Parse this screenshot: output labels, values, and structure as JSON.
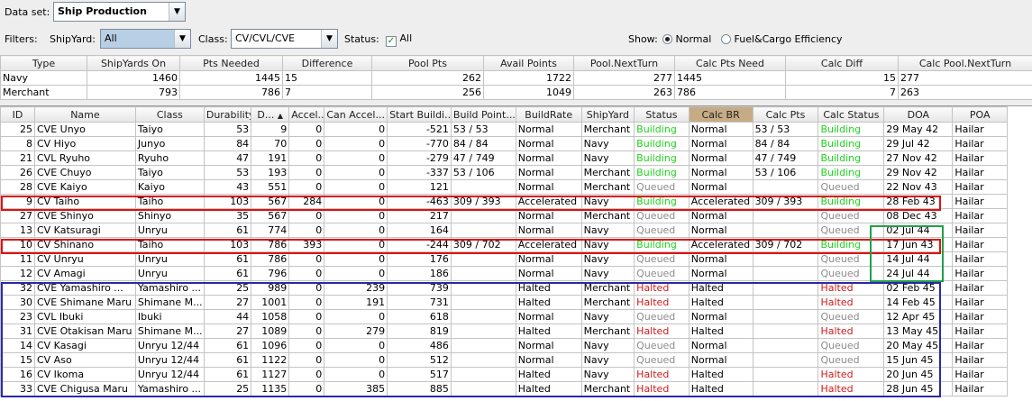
{
  "toolbar": {
    "dataset_label": "Data set:",
    "dataset_value": "Ship Production",
    "filters_label": "Filters:",
    "shipyard_label": "ShipYard:",
    "shipyard_value": "All",
    "class_label": "Class:",
    "class_value": "CV/CVL/CVE",
    "status_label": "Status:",
    "status_value": "All",
    "show_label": "Show:",
    "show_normal": "Normal",
    "show_fuel": "Fuel&Cargo Efficiency"
  },
  "summary": {
    "headers": [
      "Type",
      "ShipYards On",
      "Pts Needed",
      "Difference",
      "Pool Pts",
      "Avail Points",
      "Pool.NextTurn",
      "Calc Pts Need",
      "Calc Diff",
      "Calc Pool.NextTurn"
    ],
    "rows": [
      [
        "Navy",
        "1460",
        "1445",
        "15",
        "262",
        "1722",
        "277",
        "1445",
        "15",
        "277"
      ],
      [
        "Merchant",
        "793",
        "786",
        "7",
        "256",
        "1049",
        "263",
        "786",
        "7",
        "263"
      ]
    ]
  },
  "table": {
    "headers": [
      "ID",
      "Name",
      "Class",
      "Durability",
      "D...",
      "Accel...",
      "Can Accel...",
      "Start Buildi...",
      "Build Point...",
      "BuildRate",
      "ShipYard",
      "Status",
      "Calc BR",
      "Calc Pts",
      "Calc Status",
      "DOA",
      "POA"
    ],
    "sort_arrow": "▲",
    "rows": [
      [
        "25",
        "CVE Unyo",
        "Taiyo",
        "53",
        "9",
        "0",
        "0",
        "-521",
        "53 / 53",
        "Normal",
        "Merchant",
        "Building",
        "Normal",
        "53 / 53",
        "Building",
        "29 May 42",
        "Hailar"
      ],
      [
        "8",
        "CV Hiyo",
        "Junyo",
        "84",
        "70",
        "0",
        "0",
        "-770",
        "84 / 84",
        "Normal",
        "Navy",
        "Building",
        "Normal",
        "84 / 84",
        "Building",
        "29 Jul 42",
        "Hailar"
      ],
      [
        "21",
        "CVL Ryuho",
        "Ryuho",
        "47",
        "191",
        "0",
        "0",
        "-279",
        "47 / 749",
        "Normal",
        "Navy",
        "Building",
        "Normal",
        "47 / 749",
        "Building",
        "27 Nov 42",
        "Hailar"
      ],
      [
        "26",
        "CVE Chuyo",
        "Taiyo",
        "53",
        "193",
        "0",
        "0",
        "-337",
        "53 / 106",
        "Normal",
        "Merchant",
        "Building",
        "Normal",
        "53 / 106",
        "Building",
        "29 Nov 42",
        "Hailar"
      ],
      [
        "28",
        "CVE Kaiyo",
        "Kaiyo",
        "43",
        "551",
        "0",
        "0",
        "121",
        "",
        "Normal",
        "Merchant",
        "Queued",
        "Normal",
        "",
        "Queued",
        "22 Nov 43",
        "Hailar"
      ],
      [
        "9",
        "CV Taiho",
        "Taiho",
        "103",
        "567",
        "284",
        "0",
        "-463",
        "309 / 393",
        "Accelerated",
        "Navy",
        "Building",
        "Accelerated",
        "309 / 393",
        "Building",
        "28 Feb 43",
        "Hailar"
      ],
      [
        "27",
        "CVE Shinyo",
        "Shinyo",
        "35",
        "567",
        "0",
        "0",
        "217",
        "",
        "Normal",
        "Merchant",
        "Queued",
        "Normal",
        "",
        "Queued",
        "08 Dec 43",
        "Hailar"
      ],
      [
        "13",
        "CV Katsuragi",
        "Unryu",
        "61",
        "774",
        "0",
        "0",
        "164",
        "",
        "Normal",
        "Navy",
        "Queued",
        "Normal",
        "",
        "Queued",
        "02 Jul 44",
        "Hailar"
      ],
      [
        "10",
        "CV Shinano",
        "Taiho",
        "103",
        "786",
        "393",
        "0",
        "-244",
        "309 / 702",
        "Accelerated",
        "Navy",
        "Building",
        "Accelerated",
        "309 / 702",
        "Building",
        "17 Jun 43",
        "Hailar"
      ],
      [
        "11",
        "CV Unryu",
        "Unryu",
        "61",
        "786",
        "0",
        "0",
        "176",
        "",
        "Normal",
        "Navy",
        "Queued",
        "Normal",
        "",
        "Queued",
        "14 Jul 44",
        "Hailar"
      ],
      [
        "12",
        "CV Amagi",
        "Unryu",
        "61",
        "796",
        "0",
        "0",
        "186",
        "",
        "Normal",
        "Navy",
        "Queued",
        "Normal",
        "",
        "Queued",
        "24 Jul 44",
        "Hailar"
      ],
      [
        "32",
        "CVE Yamashiro ...",
        "Yamashiro ...",
        "25",
        "989",
        "0",
        "239",
        "739",
        "",
        "Halted",
        "Merchant",
        "Halted",
        "Halted",
        "",
        "Halted",
        "02 Feb 45",
        "Hailar"
      ],
      [
        "30",
        "CVE Shimane Maru",
        "Shimane M...",
        "27",
        "1001",
        "0",
        "191",
        "731",
        "",
        "Halted",
        "Merchant",
        "Halted",
        "Halted",
        "",
        "Halted",
        "14 Feb 45",
        "Hailar"
      ],
      [
        "23",
        "CVL Ibuki",
        "Ibuki",
        "44",
        "1058",
        "0",
        "0",
        "618",
        "",
        "Normal",
        "Navy",
        "Queued",
        "Normal",
        "",
        "Queued",
        "12 Apr 45",
        "Hailar"
      ],
      [
        "31",
        "CVE Otakisan Maru",
        "Shimane M...",
        "27",
        "1089",
        "0",
        "279",
        "819",
        "",
        "Halted",
        "Merchant",
        "Halted",
        "Halted",
        "",
        "Halted",
        "13 May 45",
        "Hailar"
      ],
      [
        "14",
        "CV Kasagi",
        "Unryu 12/44",
        "61",
        "1096",
        "0",
        "0",
        "486",
        "",
        "Normal",
        "Navy",
        "Queued",
        "Normal",
        "",
        "Queued",
        "20 May 45",
        "Hailar"
      ],
      [
        "15",
        "CV Aso",
        "Unryu 12/44",
        "61",
        "1122",
        "0",
        "0",
        "512",
        "",
        "Normal",
        "Navy",
        "Queued",
        "Normal",
        "",
        "Queued",
        "15 Jun 45",
        "Hailar"
      ],
      [
        "16",
        "CV Ikoma",
        "Unryu 12/44",
        "61",
        "1127",
        "0",
        "0",
        "517",
        "",
        "Halted",
        "Navy",
        "Halted",
        "Halted",
        "",
        "Halted",
        "20 Jun 45",
        "Hailar"
      ],
      [
        "33",
        "CVE Chigusa Maru",
        "Yamashiro ...",
        "25",
        "1135",
        "0",
        "385",
        "885",
        "",
        "Halted",
        "Merchant",
        "Halted",
        "Halted",
        "",
        "Halted",
        "28 Jun 45",
        "Hailar"
      ]
    ]
  },
  "colors": {
    "building": "#1fd21f",
    "queued": "#8c8c8c",
    "halted": "#d11a1a",
    "calc_br_header": "#c7ab84",
    "highlight_red": "#e01010",
    "highlight_green": "#22a04a",
    "highlight_blue": "#2a2aa8"
  }
}
